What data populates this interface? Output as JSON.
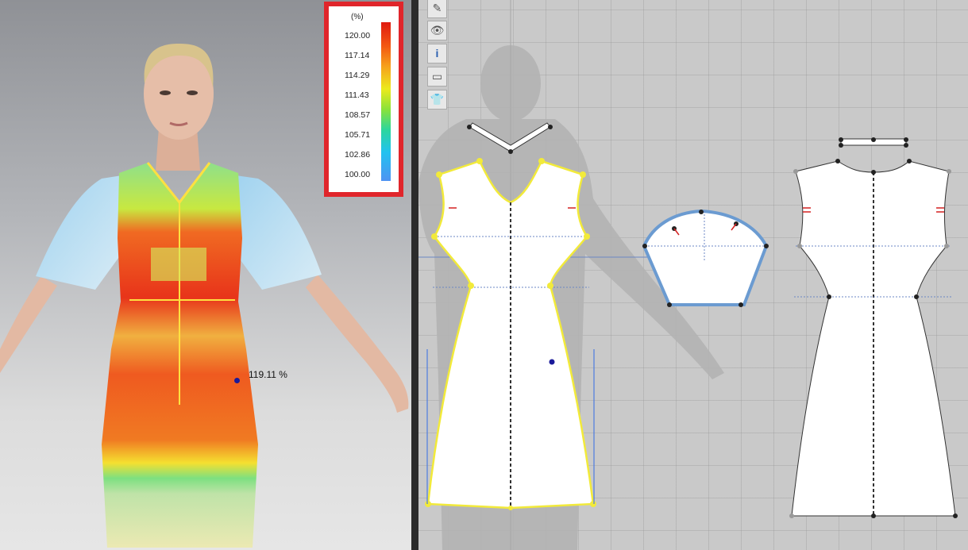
{
  "legend": {
    "unit": "(%)",
    "ticks": [
      "120.00",
      "117.14",
      "114.29",
      "111.43",
      "108.57",
      "105.71",
      "102.86",
      "100.00"
    ],
    "gradient_colors": [
      "#e01a10",
      "#f6a21c",
      "#ecea1c",
      "#2bd69e",
      "#4f93f2"
    ]
  },
  "measurement": {
    "label": "119.11 %"
  },
  "toolbar": {
    "icons": [
      "edit-brush-icon",
      "show-avatar-icon",
      "info-icon",
      "texture-icon",
      "garment-lock-icon"
    ]
  },
  "colors": {
    "highlight": "#ffee33",
    "selected_outline": "#6b9bd1",
    "legend_border": "#e0252b"
  }
}
